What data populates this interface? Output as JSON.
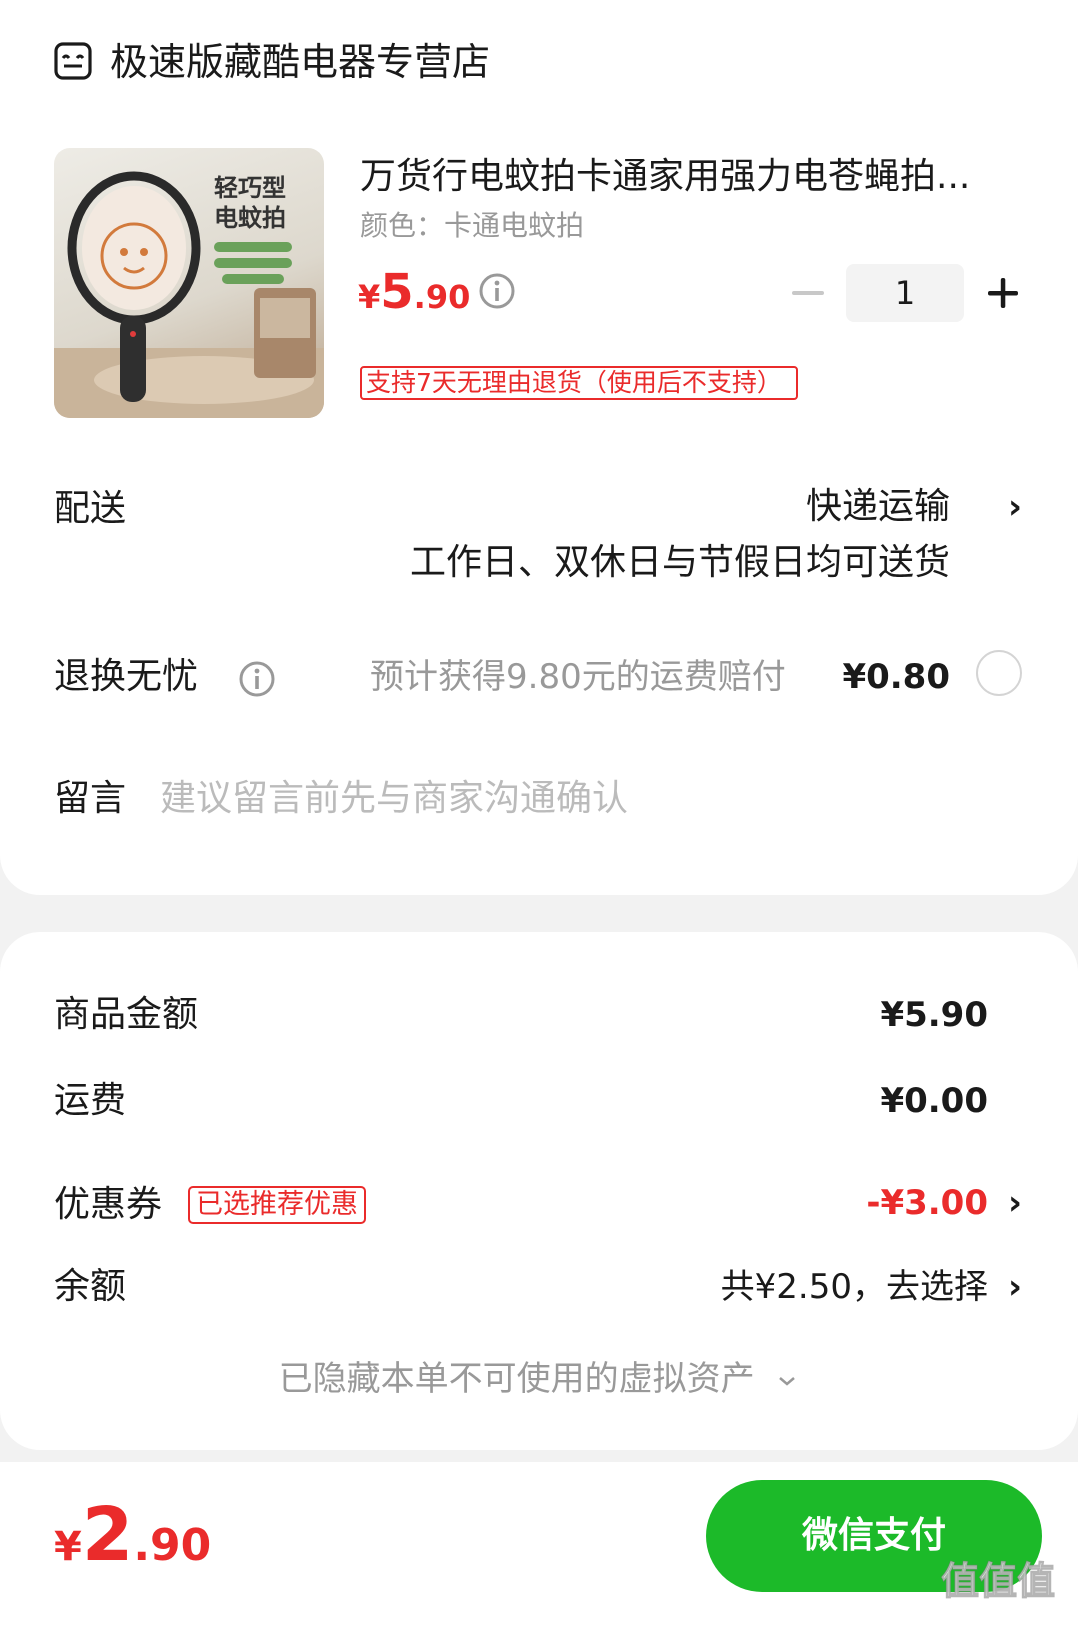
{
  "store": {
    "name": "极速版藏酷电器专营店",
    "icon": "store-icon"
  },
  "product": {
    "title": "万货行电蚊拍卡通家用强力电苍蝇拍...",
    "spec": "颜色：卡通电蚊拍",
    "price_currency": "¥",
    "price_int": "5",
    "price_dec": ".90",
    "quantity": "1",
    "return_policy": "支持7天无理由退货（使用后不支持）",
    "image_text_line1": "轻巧型",
    "image_text_line2": "电蚊拍"
  },
  "delivery": {
    "label": "配送",
    "method": "快递运输",
    "note": "工作日、双休日与节假日均可送货"
  },
  "refund": {
    "label": "退换无忧",
    "note": "预计获得9.80元的运费赔付",
    "price": "¥0.80"
  },
  "message": {
    "label": "留言",
    "placeholder": "建议留言前先与商家沟通确认"
  },
  "summary": {
    "goods_label": "商品金额",
    "goods_value": "¥5.90",
    "shipping_label": "运费",
    "shipping_value": "¥0.00",
    "coupon_label": "优惠券",
    "coupon_badge": "已选推荐优惠",
    "coupon_value": "-¥3.00",
    "balance_label": "余额",
    "balance_value": "共¥2.50，去选择",
    "hidden_note": "已隐藏本单不可使用的虚拟资产"
  },
  "footer": {
    "total_currency": "¥",
    "total_int": "2",
    "total_dec": ".90",
    "pay_label": "微信支付",
    "watermark": "值值值"
  },
  "colors": {
    "accent_red": "#ea2b2b",
    "pay_green": "#1cba29",
    "muted_text": "#999999"
  }
}
